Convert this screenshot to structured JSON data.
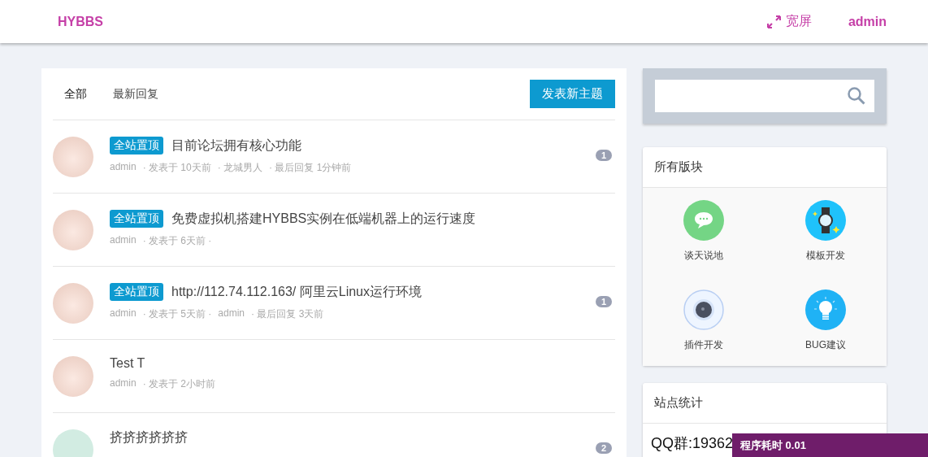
{
  "header": {
    "logo": "HYBBS",
    "widescreen": "宽屏",
    "user": "admin"
  },
  "tabs": [
    {
      "label": "全部",
      "selected": true
    },
    {
      "label": "最新回复",
      "selected": false
    }
  ],
  "new_topic_button": "发表新主题",
  "threads": [
    {
      "kind": "anime",
      "badge": "全站置顶",
      "title": "目前论坛拥有核心功能",
      "meta": [
        "admin",
        "· 发表于 10天前",
        "· 龙城男人",
        "· 最后回复 1分钟前"
      ],
      "replies": "1"
    },
    {
      "kind": "anime",
      "badge": "全站置顶",
      "title": "免费虚拟机搭建HYBBS实例在低端机器上的运行速度",
      "meta": [
        "admin",
        "· 发表于 6天前 ·"
      ]
    },
    {
      "kind": "anime",
      "badge": "全站置顶",
      "title": "http://112.74.112.163/ 阿里云Linux运行环境",
      "meta": [
        "admin",
        "· 发表于 5天前 ·",
        "admin",
        "· 最后回复 3天前"
      ],
      "replies": "1"
    },
    {
      "kind": "anime",
      "title": "Test T",
      "meta": [
        "admin",
        "· 发表于 2小时前"
      ]
    },
    {
      "kind": "bear",
      "title": "挤挤挤挤挤挤",
      "replies": "2"
    }
  ],
  "forums": {
    "title": "所有版块",
    "items": [
      {
        "kind": "chat",
        "name": "谈天说地"
      },
      {
        "kind": "watch",
        "name": "模板开发"
      },
      {
        "kind": "lens",
        "name": "插件开发"
      },
      {
        "kind": "bulb",
        "name": "BUG建议"
      }
    ]
  },
  "stats": {
    "title": "站点统计",
    "line": "QQ群:19362"
  },
  "debug_bar": "程序耗时 0.01"
}
